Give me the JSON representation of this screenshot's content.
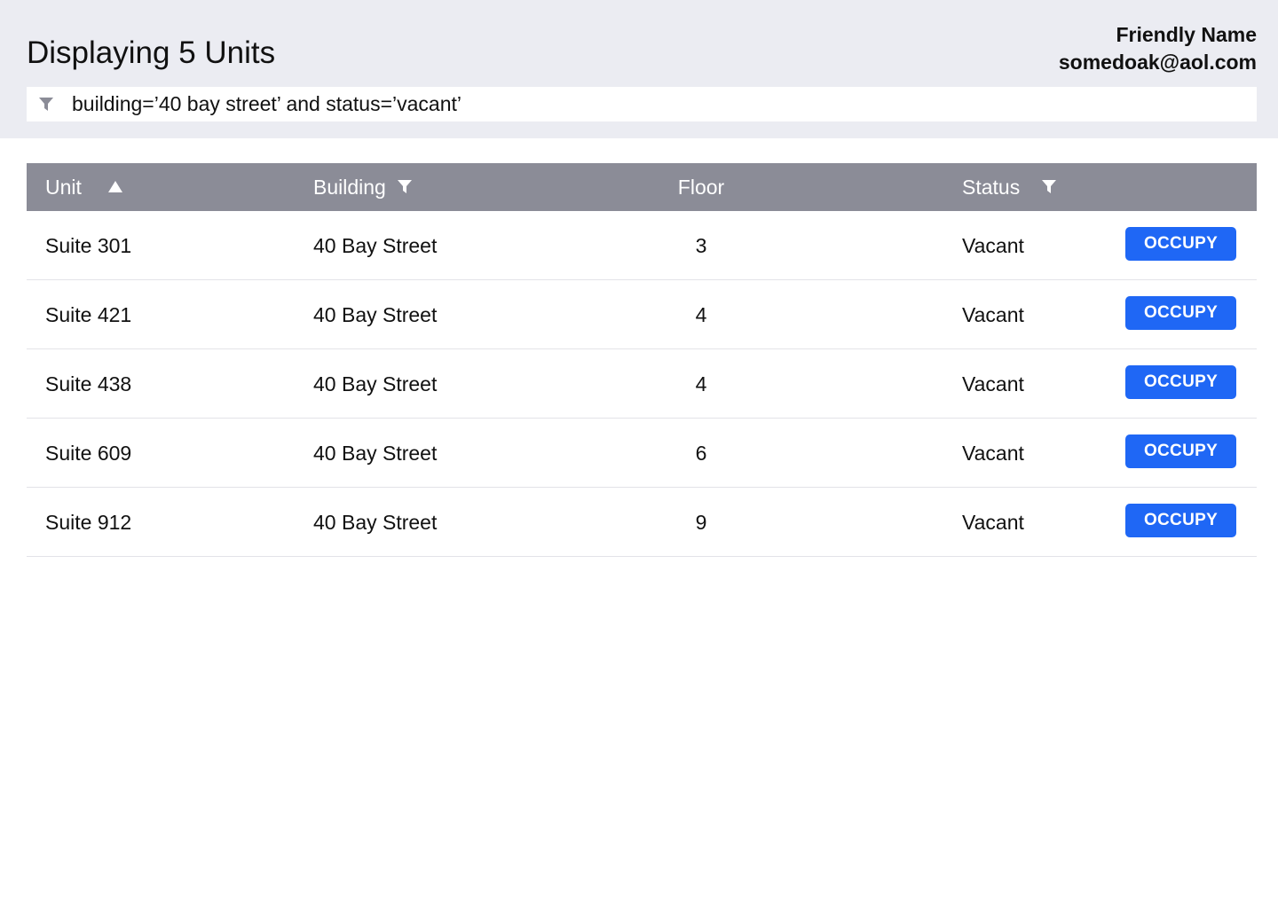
{
  "header": {
    "title": "Displaying 5 Units",
    "user_name": "Friendly Name",
    "user_email": "somedoak@aol.com"
  },
  "filter": {
    "icon": "filter-icon",
    "query": "building=’40 bay street’ and status=’vacant’"
  },
  "table": {
    "columns": {
      "unit": "Unit",
      "building": "Building",
      "floor": "Floor",
      "status": "Status"
    },
    "rows": [
      {
        "unit": "Suite 301",
        "building": "40 Bay Street",
        "floor": "3",
        "status": "Vacant",
        "action": "OCCUPY"
      },
      {
        "unit": "Suite 421",
        "building": "40 Bay Street",
        "floor": "4",
        "status": "Vacant",
        "action": "OCCUPY"
      },
      {
        "unit": "Suite 438",
        "building": "40 Bay Street",
        "floor": "4",
        "status": "Vacant",
        "action": "OCCUPY"
      },
      {
        "unit": "Suite 609",
        "building": "40 Bay Street",
        "floor": "6",
        "status": "Vacant",
        "action": "OCCUPY"
      },
      {
        "unit": "Suite 912",
        "building": "40 Bay Street",
        "floor": "9",
        "status": "Vacant",
        "action": "OCCUPY"
      }
    ]
  },
  "colors": {
    "header_bg": "#ebecf2",
    "table_header_bg": "#8b8c97",
    "accent": "#1f67f5"
  }
}
